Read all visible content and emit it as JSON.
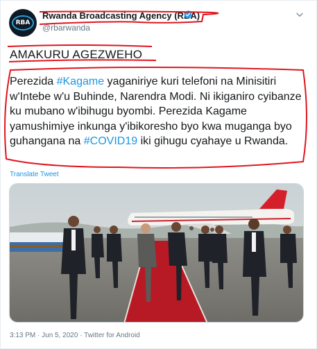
{
  "account": {
    "display_name": "Rwanda Broadcasting Agency (RBA)",
    "handle": "@rbarwanda",
    "avatar_text": "RBA",
    "verified": true
  },
  "tweet": {
    "headline": "AMAKURU AGEZWEHO",
    "body": {
      "part1": "Perezida ",
      "hashtag1": "#Kagame",
      "part2": " yaganiriye kuri telefoni na Minisitiri w'Intebe w'u Buhinde, Narendra Modi. Ni ikiganiro cyibanze ku mubano w'ibihugu byombi. Perezida Kagame yamushimiye inkunga y'ibikoresho byo kwa muganga byo guhangana na ",
      "hashtag2": "#COVID19",
      "part3": " iki gihugu cyahaye u Rwanda."
    },
    "translate_label": "Translate Tweet",
    "time": "3:13 PM",
    "separator": "·",
    "date": "Jun 5, 2020",
    "source": "Twitter for Android"
  },
  "colors": {
    "link": "#1b95e0",
    "annotation": "#e0141e",
    "muted": "#657786"
  },
  "icons": {
    "verified": "verified-badge-icon",
    "menu": "chevron-down-icon"
  }
}
